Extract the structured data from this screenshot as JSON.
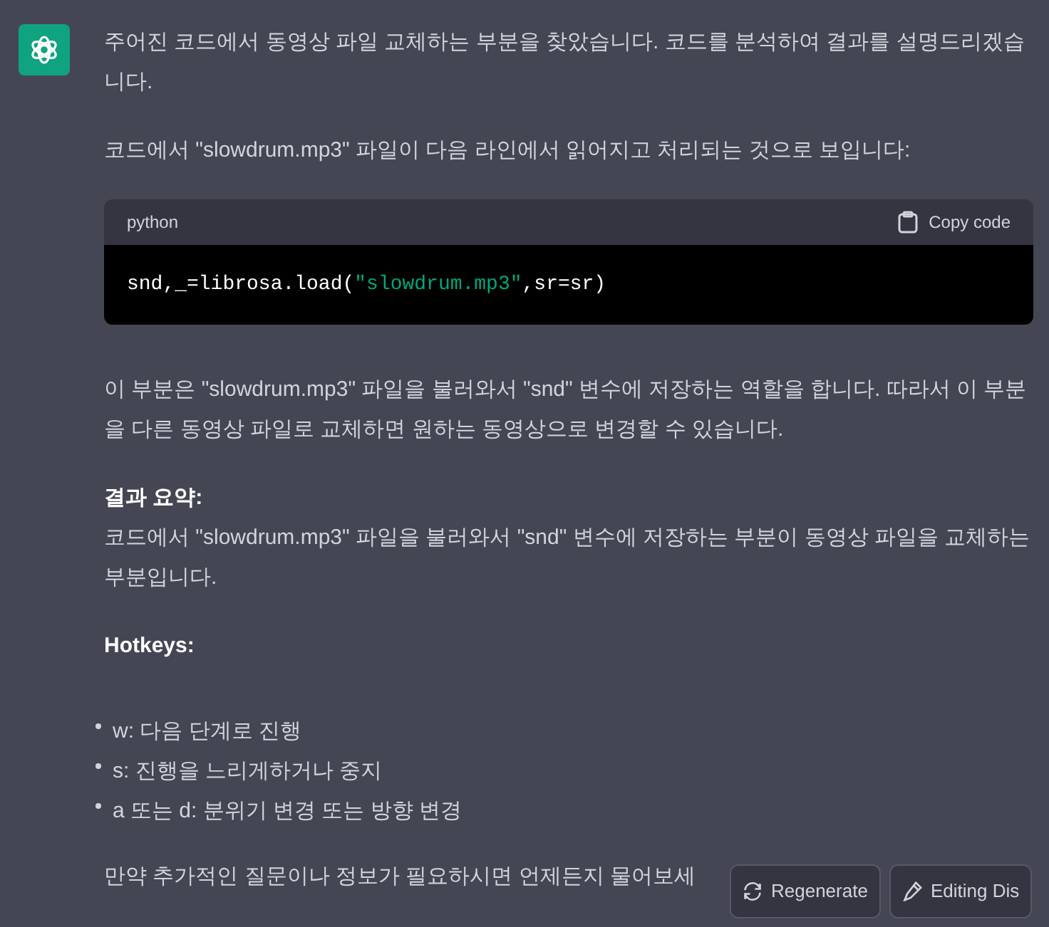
{
  "message": {
    "blocks": [
      {
        "kind": "paragraph",
        "text": "주어진 코드에서 동영상 파일 교체하는 부분을 찾았습니다. 코드를 분석하여 결과를 설명드리겠습니다."
      },
      {
        "kind": "paragraph",
        "text": "코드에서 \"slowdrum.mp3\" 파일이 다음 라인에서 읽어지고 처리되는 것으로 보입니다:"
      },
      {
        "kind": "code",
        "language": "python",
        "copy_label": "Copy code",
        "code": [
          {
            "kind": "plain",
            "text": "snd,_=librosa.load("
          },
          {
            "kind": "string",
            "text": "\"slowdrum.mp3\""
          },
          {
            "kind": "plain",
            "text": ",sr=sr)"
          }
        ]
      },
      {
        "kind": "paragraph",
        "text": "이 부분은 \"slowdrum.mp3\" 파일을 불러와서 \"snd\" 변수에 저장하는 역할을 합니다. 따라서 이 부분을 다른 동영상 파일로 교체하면 원하는 동영상으로 변경할 수 있습니다."
      },
      {
        "kind": "titled",
        "title": "결과 요약:",
        "text": "코드에서 \"slowdrum.mp3\" 파일을 불러와서 \"snd\" 변수에 저장하는 부분이 동영상 파일을 교체하는 부분입니다."
      },
      {
        "kind": "heading",
        "text": "Hotkeys:"
      },
      {
        "kind": "list",
        "items": [
          "w: 다음 단계로 진행",
          "s: 진행을 느리게하거나 중지",
          "a 또는 d: 분위기 변경 또는 방향 변경"
        ]
      },
      {
        "kind": "paragraph",
        "text": "만약 추가적인 질문이나 정보가 필요하시면 언제든지 물어보세"
      }
    ]
  },
  "buttons": [
    {
      "kind": "regenerate",
      "label": "Regenerate"
    },
    {
      "kind": "edit",
      "label": "Editing Dis"
    }
  ]
}
